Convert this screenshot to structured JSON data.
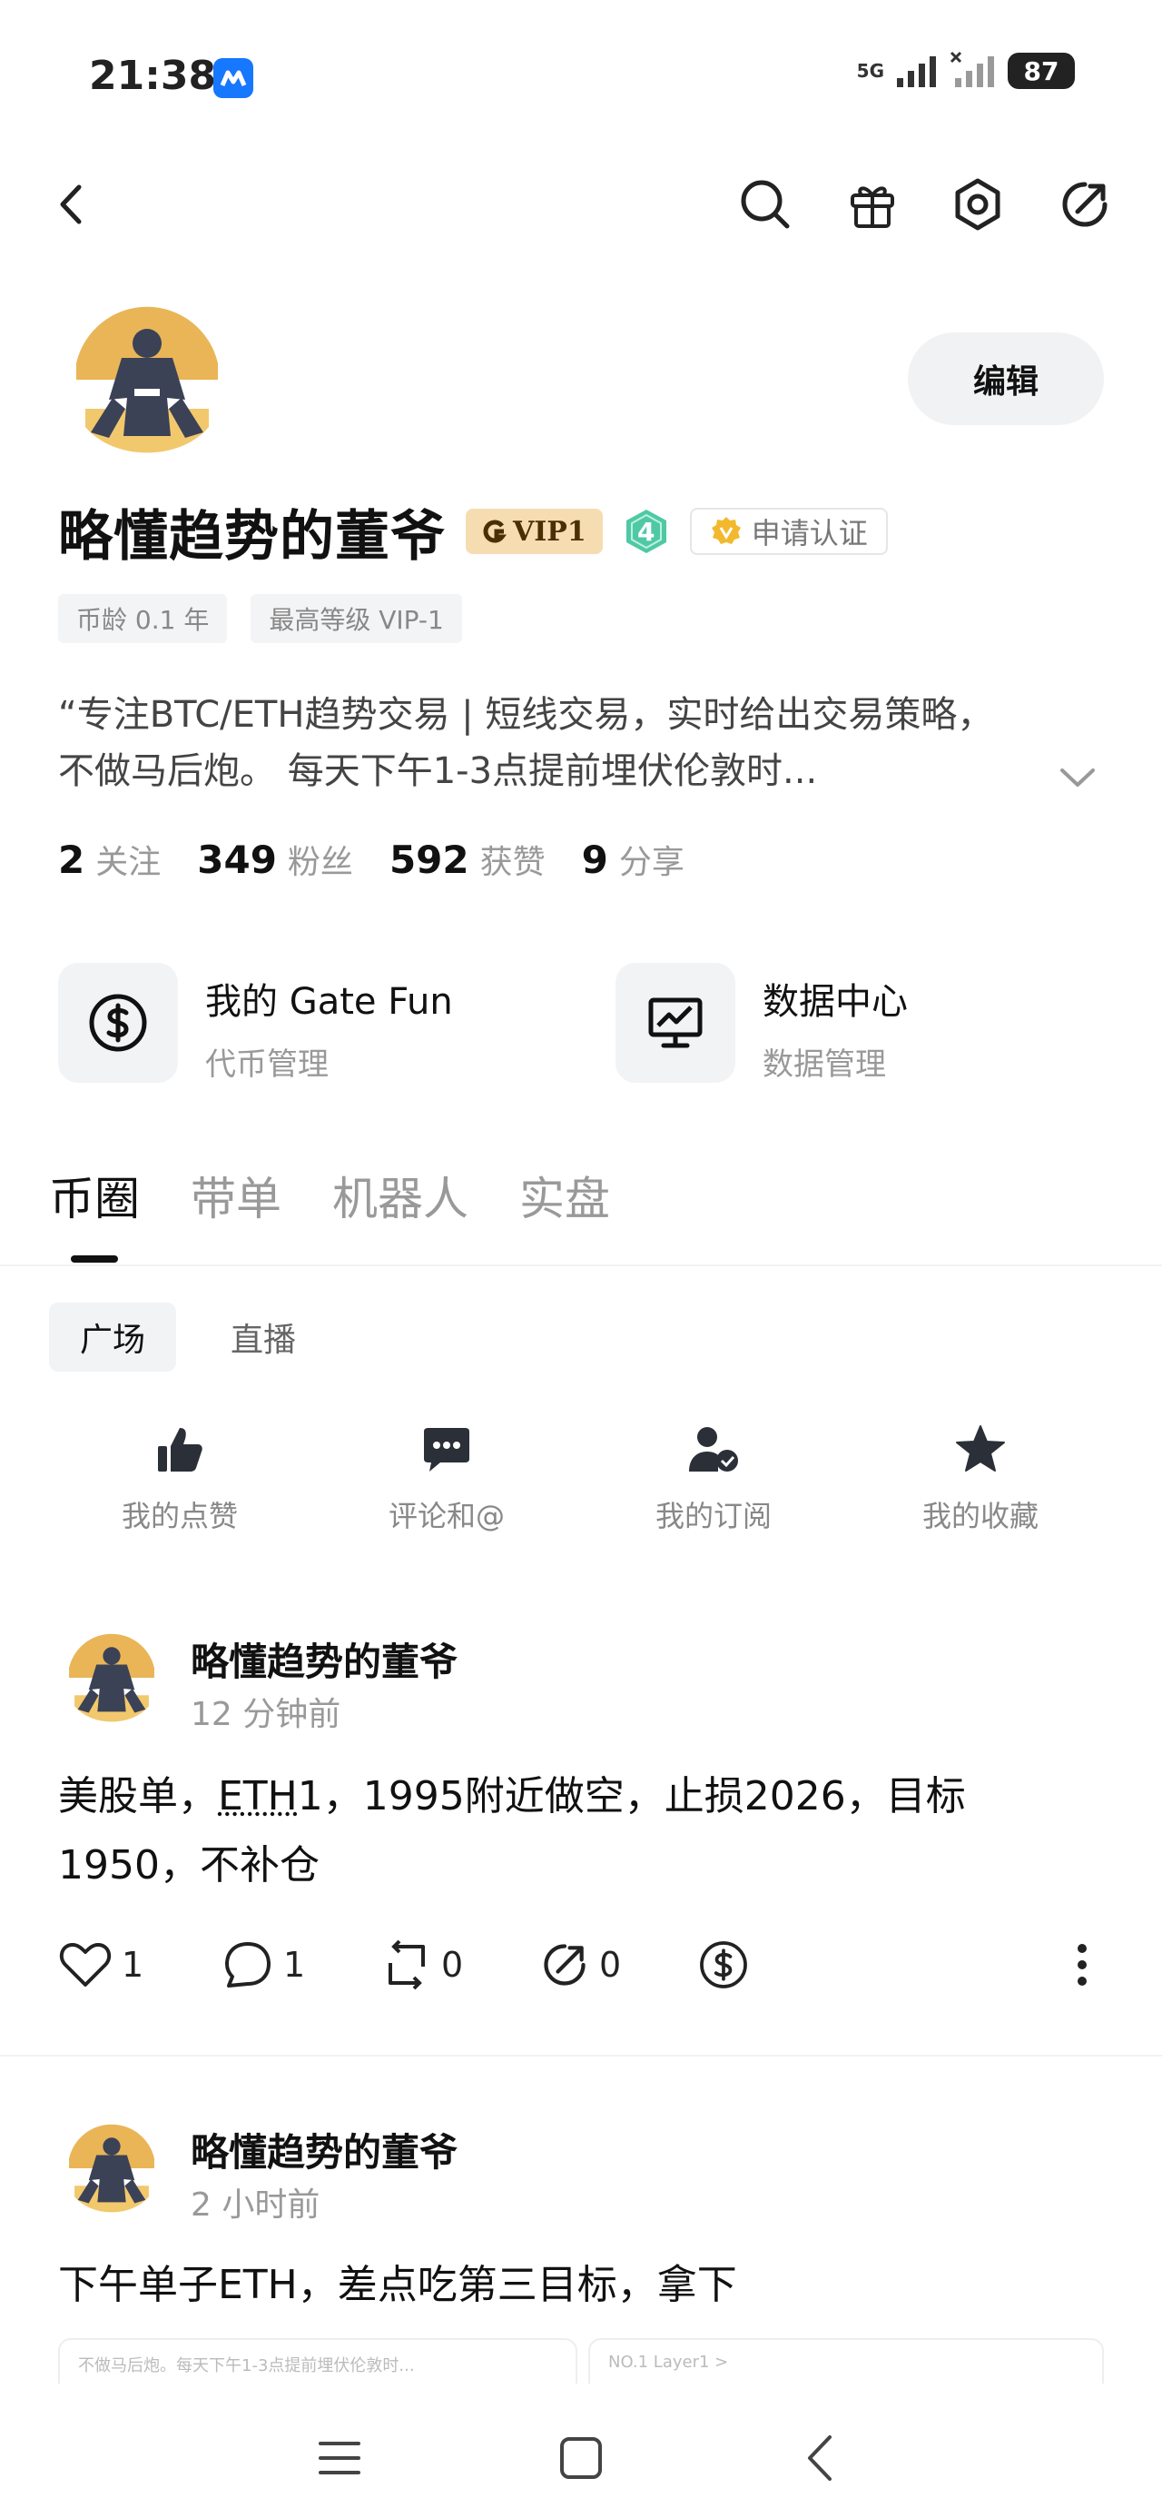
{
  "status_bar": {
    "time": "21:38",
    "network": "5G",
    "battery": "87"
  },
  "profile": {
    "name": "略懂趋势的董爷",
    "vip": "VIP1",
    "level": "4",
    "verify_label": "申请认证",
    "edit_label": "编辑",
    "tags": [
      "币龄 0.1 年",
      "最高等级 VIP-1"
    ],
    "bio_line1": "“专注BTC/ETH趋势交易 | 短线交易，实时给出交易策略，",
    "bio_line2": "不做马后炮。 每天下午1-3点提前埋伏伦敦时...",
    "stats": [
      {
        "value": "2",
        "label": "关注"
      },
      {
        "value": "349",
        "label": "粉丝"
      },
      {
        "value": "592",
        "label": "获赞"
      },
      {
        "value": "9",
        "label": "分享"
      }
    ]
  },
  "quick_links": [
    {
      "title": "我的 Gate Fun",
      "subtitle": "代币管理",
      "icon": "dollar-circle-icon"
    },
    {
      "title": "数据中心",
      "subtitle": "数据管理",
      "icon": "chart-monitor-icon"
    }
  ],
  "main_tabs": [
    "币圈",
    "带单",
    "机器人",
    "实盘"
  ],
  "sub_tabs": [
    "广场",
    "直播"
  ],
  "actions": [
    {
      "label": "我的点赞",
      "icon": "thumbs-up-icon"
    },
    {
      "label": "评论和@",
      "icon": "comment-icon"
    },
    {
      "label": "我的订阅",
      "icon": "subscribe-user-icon"
    },
    {
      "label": "我的收藏",
      "icon": "star-icon"
    }
  ],
  "posts": [
    {
      "author": "略懂趋势的董爷",
      "time": "12 分钟前",
      "body_prefix": "美股单，",
      "ticker": "ETH",
      "body_line1_rest": "1，1995附近做空，止损2026，目标",
      "body_line2": "1950，不补仓",
      "likes": "1",
      "comments": "1",
      "reposts": "0",
      "shares": "0"
    },
    {
      "author": "略懂趋势的董爷",
      "time": "2 小时前",
      "body": "下午单子ETH，差点吃第三目标，拿下",
      "preview_left": "不做马后炮。每天下午1-3点提前埋伏伦敦时...",
      "preview_right": "NO.1   Layer1 >"
    }
  ],
  "colors": {
    "vip_bg": "#f6dcb1",
    "level_badge": "#4fc9a4",
    "verify_gold": "#f2b92e",
    "accent_blue": "#1677ff",
    "avatar_ring": "#e9b557",
    "avatar_figure": "#3b4256"
  }
}
